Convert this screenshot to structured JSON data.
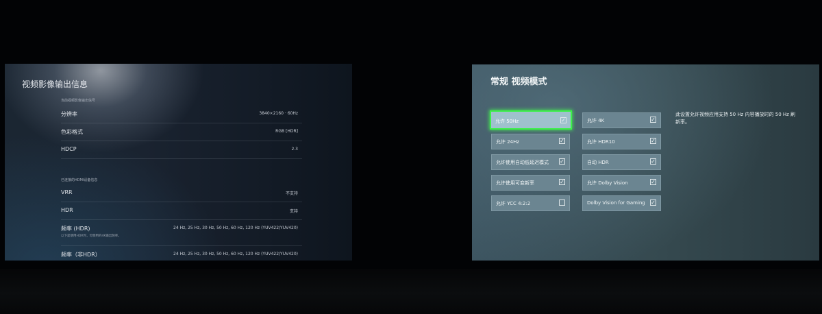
{
  "left": {
    "title": "视频影像输出信息",
    "section1_label": "当前视频影像输出信号",
    "rows1": [
      {
        "label": "分辨率",
        "value": "3840×2160 · 60Hz"
      },
      {
        "label": "色彩格式",
        "value": "RGB [HDR]"
      },
      {
        "label": "HDCP",
        "value": "2.3"
      }
    ],
    "section2_label": "已连接的HDMI设备信息",
    "rows2": [
      {
        "label": "VRR",
        "value": "不支持"
      },
      {
        "label": "HDR",
        "value": "支持"
      },
      {
        "label": "频率 (HDR)",
        "value": "24 Hz, 25 Hz, 30 Hz, 50 Hz, 60 Hz, 120 Hz (YUV422/YUV420)",
        "sub": "以下是使用HDR时，可使用的4K输出频率。"
      },
      {
        "label": "频率（非HDR）",
        "value": "24 Hz, 25 Hz, 30 Hz, 50 Hz, 60 Hz, 120 Hz (YUV422/YUV420)"
      }
    ]
  },
  "right": {
    "title": "常规  视频模式",
    "options_left": [
      {
        "label": "允许 50Hz",
        "checked": true,
        "selected": true
      },
      {
        "label": "允许 24Hz",
        "checked": true,
        "selected": false
      },
      {
        "label": "允许使用自动低延迟模式",
        "checked": true,
        "selected": false
      },
      {
        "label": "允许使用可变新率",
        "checked": true,
        "selected": false
      },
      {
        "label": "允许 YCC 4:2:2",
        "checked": false,
        "selected": false
      }
    ],
    "options_right": [
      {
        "label": "允许 4K",
        "checked": true
      },
      {
        "label": "允许 HDR10",
        "checked": true
      },
      {
        "label": "自动 HDR",
        "checked": true
      },
      {
        "label": "允许 Dolby Vision",
        "checked": true
      },
      {
        "label": "Dolby Vision for Gaming",
        "checked": true
      }
    ],
    "description": "此设置允许视频应用支持 50 Hz 内容播放时的 50 Hz 刷新率。",
    "check_glyph": "✓",
    "highlight_color": "#3cf04a"
  }
}
